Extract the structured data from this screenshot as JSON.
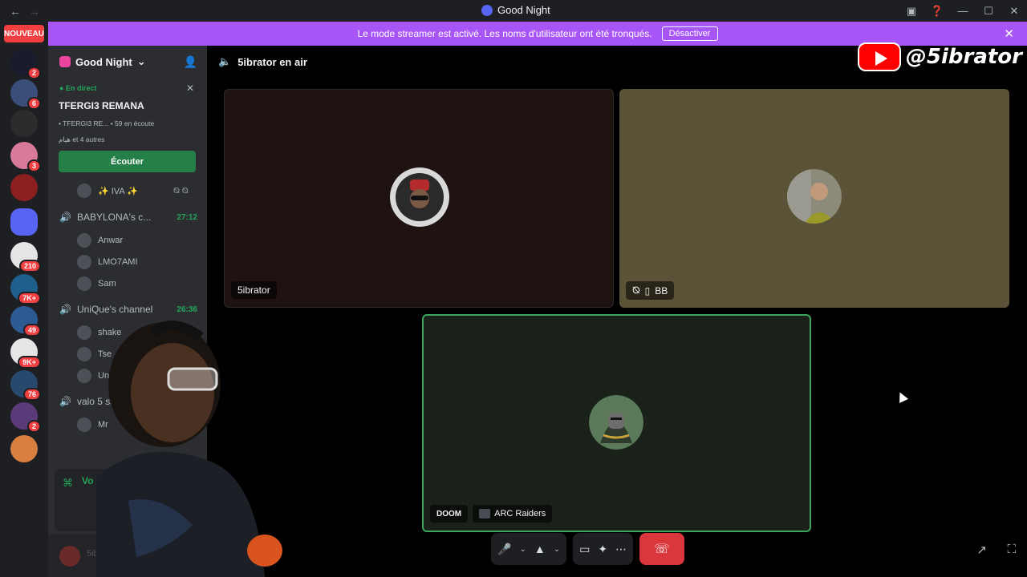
{
  "titlebar": {
    "title": "Good Night"
  },
  "rail": {
    "nouveau_label": "NOUVEAU",
    "servers": [
      {
        "badge": "2",
        "color": "#1b1b2e"
      },
      {
        "badge": "6",
        "color": "#3b4e7a"
      },
      {
        "badge": "",
        "color": "#2c2c2c"
      },
      {
        "badge": "3",
        "color": "#d97a9b"
      },
      {
        "badge": "",
        "color": "#8c1f1f"
      },
      {
        "badge": "",
        "color": "#5865f2"
      },
      {
        "badge": "210",
        "color": "#e5e5e5"
      },
      {
        "badge": "7K+",
        "color": "#1f5f8b"
      },
      {
        "badge": "49",
        "color": "#2c5b94"
      },
      {
        "badge": "9K+",
        "color": "#e5e5e5"
      },
      {
        "badge": "76",
        "color": "#27496d"
      },
      {
        "badge": "2",
        "color": "#5b3a7a"
      },
      {
        "badge": "",
        "color": "#d98040"
      }
    ]
  },
  "banner": {
    "text": "Le mode streamer est activé. Les noms d'utilisateur ont été tronqués.",
    "button_label": "Désactiver"
  },
  "sidebar": {
    "server_name": "Good Night",
    "live": {
      "tag": "En direct",
      "name": "TFERGI3 REMANA",
      "meta": "• TFERGI3 RE...  •  59 en écoute",
      "participants": "هيام et 4 autres",
      "listen_label": "Écouter"
    },
    "iva_member": "✨ IVA ✨",
    "channels": [
      {
        "name": "BABYLONA's c...",
        "time": "27:12",
        "members": [
          "Anwar",
          "LMO7AMI",
          "Sam"
        ]
      },
      {
        "name": "UniQue's channel",
        "time": "26:36",
        "members": [
          "shake",
          "Tse",
          "Uni"
        ]
      },
      {
        "name": "valo 5 st",
        "time": "",
        "members": [
          "Mr"
        ]
      }
    ],
    "voice_label": "Vo",
    "username": "5ibrator"
  },
  "call": {
    "channel_title": "5ibrator en air",
    "brand_handle": "@5ibrator",
    "tiles": {
      "one": {
        "name": "5ibrator"
      },
      "two": {
        "name": "BB"
      },
      "three": {
        "tag": "DOOM",
        "activity": "ARC Raiders"
      }
    }
  },
  "colors": {
    "accent": "#5865f2",
    "banner": "#a855f7",
    "live_green": "#23a55a",
    "end_call": "#da373c"
  }
}
